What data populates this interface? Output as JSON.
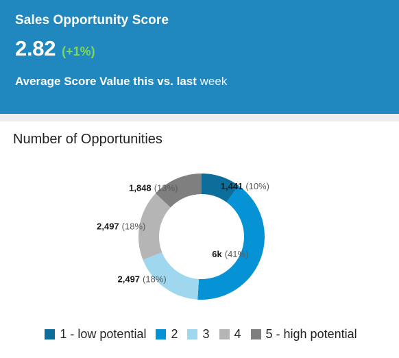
{
  "kpi": {
    "title": "Sales Opportunity Score",
    "value": "2.82",
    "delta": "(+1%)",
    "delta_color": "#7ed957",
    "subtitle_strong": "Average Score Value this vs. last",
    "subtitle_light": "week",
    "background_color": "#2088be"
  },
  "chart": {
    "title": "Number of Opportunities"
  },
  "chart_data": {
    "type": "pie",
    "title": "Number of Opportunities",
    "variant": "donut",
    "legend_position": "bottom",
    "categories": [
      "1 - low potential",
      "2",
      "3",
      "4",
      "5 - high potential"
    ],
    "values": [
      1441,
      6000,
      2497,
      2497,
      1848
    ],
    "percents": [
      10,
      41,
      18,
      18,
      13
    ],
    "colors": [
      "#0d6e9b",
      "#0693d6",
      "#9ed7ee",
      "#b5b5b5",
      "#7f7f7f"
    ],
    "slice_labels": [
      {
        "value": "1,441",
        "percent": "(10%)"
      },
      {
        "value": "6k",
        "percent": "(41%)"
      },
      {
        "value": "2,497",
        "percent": "(18%)"
      },
      {
        "value": "2,497",
        "percent": "(18%)"
      },
      {
        "value": "1,848",
        "percent": "(13%)"
      }
    ],
    "xlabel": "",
    "ylabel": ""
  },
  "legend": {
    "items": [
      {
        "label": "1 - low potential",
        "color": "#0d6e9b"
      },
      {
        "label": "2",
        "color": "#0693d6"
      },
      {
        "label": "3",
        "color": "#9ed7ee"
      },
      {
        "label": "4",
        "color": "#b5b5b5"
      },
      {
        "label": "5 - high potential",
        "color": "#7f7f7f"
      }
    ]
  }
}
